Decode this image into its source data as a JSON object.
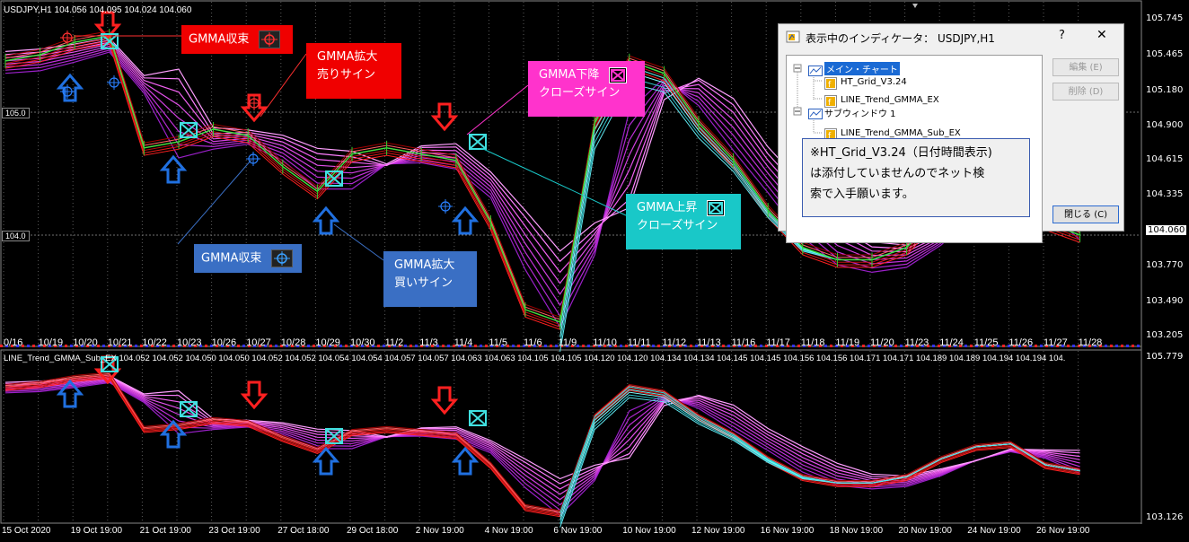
{
  "window": {
    "title": "USDJPY,H1  104.056 104.095 104.024 104.060",
    "subwindow_title": "LINE_Trend_GMMA_Sub_EX 104.052 104.052 104.050 104.050 104.052 104.052 104.054 104.054 104.057 104.057 104.063 104.063 104.105 104.105 104.120 104.120 104.134 104.134 104.145 104.145 104.156 104.156 104.171 104.171 104.189 104.189 104.194 104.194 104."
  },
  "price_axis": {
    "main": [
      "105.745",
      "105.465",
      "105.180",
      "104.900",
      "104.615",
      "104.335",
      "104.060",
      "103.770",
      "103.490",
      "103.205"
    ],
    "sub": [
      "105.779",
      "103.126"
    ],
    "left_marks": [
      "105.0",
      "104.0"
    ]
  },
  "date_axis_main": [
    "0/16",
    "10/19",
    "10/20",
    "10/21",
    "10/22",
    "10/23",
    "10/26",
    "10/27",
    "10/28",
    "10/29",
    "10/30",
    "11/2",
    "11/3",
    "11/4",
    "11/5",
    "11/6",
    "11/9",
    "11/10",
    "11/11",
    "11/12",
    "11/13",
    "11/16",
    "11/17",
    "11/18",
    "11/19",
    "11/20",
    "11/23",
    "11/24",
    "11/25",
    "11/26",
    "11/27",
    "11/28"
  ],
  "date_axis_bottom": [
    "15 Oct 2020",
    "19 Oct 19:00",
    "21 Oct 19:00",
    "23 Oct 19:00",
    "27 Oct 18:00",
    "29 Oct 18:00",
    "2 Nov 19:00",
    "4 Nov 19:00",
    "6 Nov 19:00",
    "10 Nov 19:00",
    "12 Nov 19:00",
    "16 Nov 19:00",
    "18 Nov 19:00",
    "20 Nov 19:00",
    "24 Nov 19:00",
    "26 Nov 19:00"
  ],
  "callouts": {
    "converge_red": "GMMA収束",
    "expand_sell_1": "GMMA拡大",
    "expand_sell_2": "売りサイン",
    "down_close_1": "GMMA下降",
    "down_close_2": "クローズサイン",
    "up_close_1": "GMMA上昇",
    "up_close_2": "クローズサイン",
    "converge_blue": "GMMA収束",
    "expand_buy_1": "GMMA拡大",
    "expand_buy_2": "買いサイン"
  },
  "dialog": {
    "title": "表示中のインディケータ： USDJPY,H1",
    "help": "?",
    "close": "✕",
    "tree": {
      "main_chart": "メイン・チャート",
      "item1": "HT_Grid_V3.24",
      "item2": "LINE_Trend_GMMA_EX",
      "sub_window": "サブウィンドウ 1",
      "item3": "LINE_Trend_GMMA_Sub_EX"
    },
    "buttons": {
      "edit": "編集 (E)",
      "delete": "削除 (D)",
      "close": "閉じる (C)"
    },
    "note_lines": [
      "※HT_Grid_V3.24（日付時間表示)",
      "は添付していませんのでネット検",
      "索で入手願います。"
    ]
  },
  "colors": {
    "red_callout": "#f00000",
    "magenta_callout": "#ff33cc",
    "cyan_callout": "#19c8c8",
    "blue_callout": "#3a6fc4",
    "grid": "#6c6c6c"
  },
  "chart_data": {
    "type": "line",
    "note_series": "GMMA short (red) and long (magenta/cyan) moving average ribbons with price",
    "x": [
      "10/16",
      "10/19",
      "10/20",
      "10/21",
      "10/22",
      "10/23",
      "10/26",
      "10/27",
      "10/28",
      "10/29",
      "10/30",
      "11/2",
      "11/3",
      "11/4",
      "11/5",
      "11/6",
      "11/9",
      "11/10",
      "11/11",
      "11/12",
      "11/13",
      "11/16",
      "11/17",
      "11/18",
      "11/19",
      "11/20",
      "11/23",
      "11/24",
      "11/25",
      "11/26",
      "11/27",
      "11/28"
    ],
    "price": [
      105.4,
      105.45,
      105.55,
      105.6,
      104.7,
      104.75,
      104.85,
      104.8,
      104.55,
      104.35,
      104.65,
      104.7,
      104.65,
      104.6,
      104.1,
      103.4,
      103.3,
      104.9,
      105.4,
      105.3,
      104.9,
      104.6,
      104.2,
      103.9,
      103.8,
      103.8,
      103.9,
      104.2,
      104.4,
      104.45,
      104.1,
      104.0
    ],
    "ylim": [
      103.205,
      105.745
    ]
  }
}
